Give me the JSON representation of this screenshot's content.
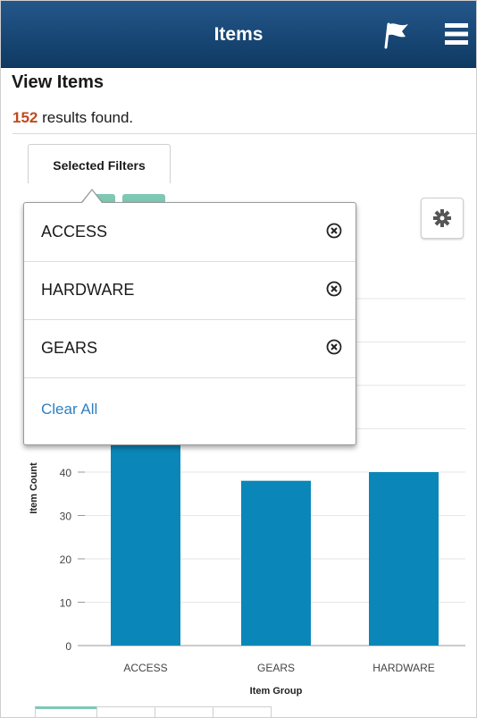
{
  "header": {
    "title": "Items",
    "flag_icon": "flag-icon",
    "menu_icon": "hamburger-menu-icon",
    "background_color": "#1b4c7a"
  },
  "page": {
    "title": "View Items",
    "results_count": "152",
    "results_suffix": " results found."
  },
  "filters": {
    "button_label": "Selected Filters",
    "items": [
      {
        "label": "ACCESS"
      },
      {
        "label": "HARDWARE"
      },
      {
        "label": "GEARS"
      }
    ],
    "clear_label": "Clear All",
    "remove_icon": "circle-x-icon"
  },
  "settings": {
    "icon": "gear-icon"
  },
  "chart_data": {
    "type": "bar",
    "categories": [
      "ACCESS",
      "GEARS",
      "HARDWARE"
    ],
    "values": [
      74,
      38,
      40
    ],
    "xlabel": "Item Group",
    "ylabel": "Item Count",
    "ylim": [
      0,
      80
    ],
    "yticks": [
      0,
      10,
      20,
      30,
      40
    ],
    "bar_color": "#0a87b8",
    "grid": true
  },
  "bottom_tabs": {
    "count": 4,
    "active_index": 0,
    "active_color": "#7ec8b4"
  }
}
